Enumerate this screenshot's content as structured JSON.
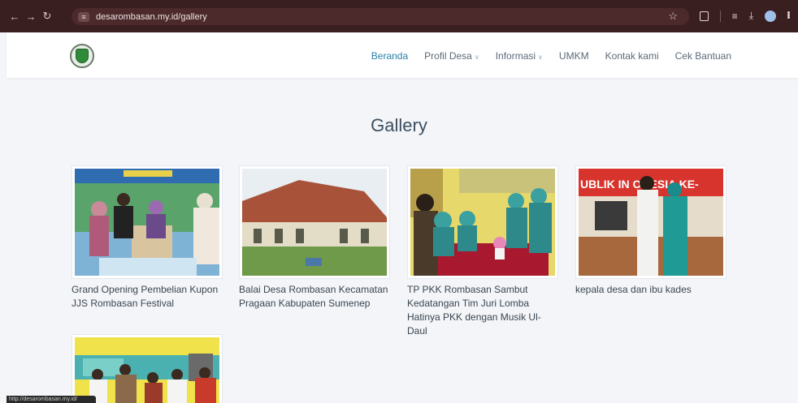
{
  "browser": {
    "url": "desarombasan.my.id/gallery",
    "status_url": "http://desarombasan.my.id/"
  },
  "nav": {
    "items": [
      {
        "label": "Beranda",
        "active": true,
        "dropdown": false
      },
      {
        "label": "Profil Desa",
        "active": false,
        "dropdown": true
      },
      {
        "label": "Informasi",
        "active": false,
        "dropdown": true
      },
      {
        "label": "UMKM",
        "active": false,
        "dropdown": false
      },
      {
        "label": "Kontak kami",
        "active": false,
        "dropdown": false
      },
      {
        "label": "Cek Bantuan",
        "active": false,
        "dropdown": false
      }
    ]
  },
  "page": {
    "title": "Gallery"
  },
  "gallery": [
    {
      "caption": "Grand Opening Pembelian Kupon JJS Rombasan Festival"
    },
    {
      "caption": "Balai Desa Rombasan Kecamatan Pragaan Kabupaten Sumenep"
    },
    {
      "caption": "TP PKK Rombasan Sambut Kedatangan Tim Juri Lomba Hatinya PKK dengan Musik Ul-Daul"
    },
    {
      "caption": "kepala desa dan ibu kades",
      "photo_banner_text": "UBLIK IN ONESIA KE-"
    },
    {
      "caption": ""
    }
  ],
  "colors": {
    "chrome": "#3a1f20",
    "nav_active": "#2a7ea6",
    "nav_text": "#5a6a7a",
    "page_bg": "#f3f5f8"
  }
}
